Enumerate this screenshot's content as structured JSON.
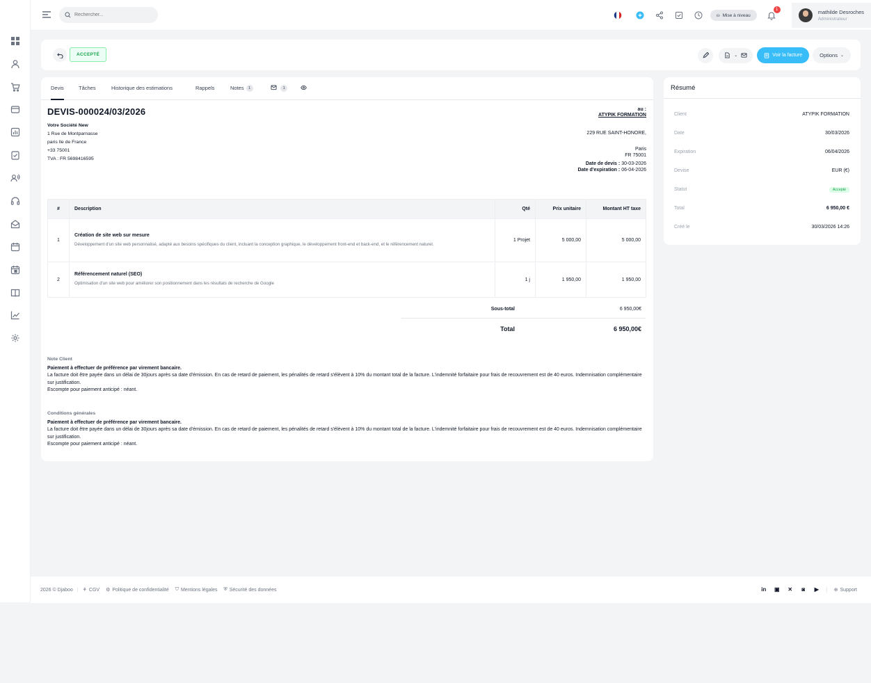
{
  "search": {
    "placeholder": "Rechercher..."
  },
  "topbar": {
    "upgrade": "Mise à niveau",
    "notif_count": "1",
    "user_name": "mathilde Desroches",
    "user_role": "Administrateur",
    "flag": "fr"
  },
  "status": {
    "badge": "ACCEPTÉ"
  },
  "actions": {
    "view_invoice": "Voir la facture",
    "options": "Options"
  },
  "tabs": [
    {
      "label": "Devis"
    },
    {
      "label": "Tâches"
    },
    {
      "label": "Historique des estimations"
    },
    {
      "label": "Rappels"
    },
    {
      "label": "Notes",
      "count": "1"
    },
    {
      "label": "",
      "count": "1"
    }
  ],
  "quote": {
    "number": "DEVIS-000024/03/2026",
    "company": "Votre Société New",
    "address1": "1 Rue de Montparnasse",
    "address2": "paris Ile de France",
    "address3": "+33 75001",
    "vat": "TVA : FR 5698416595",
    "to_label": "au :",
    "client": "ATYPIK FORMATION",
    "client_street": "229 RUE SAINT-HONORE,",
    "client_city": "Paris",
    "client_zip": "FR 75001",
    "date_label": "Date de devis :",
    "date_value": "30-03-2026",
    "exp_label": "Date d'expiration :",
    "exp_value": "06-04-2026"
  },
  "table": {
    "headers": [
      "#",
      "Description",
      "Qté",
      "Prix unitaire",
      "Montant HT taxe"
    ],
    "rows": [
      {
        "num": "1",
        "title": "Création de site web sur mesure",
        "desc": "Développement d'un site web personnalisé, adapté aux besoins spécifiques du client, incluant la conception graphique, le développement front-end et back-end, et le référencement naturel.",
        "qty": "1 Projet",
        "price": "5 000,00",
        "amount": "5 000,00"
      },
      {
        "num": "2",
        "title": "Référencement naturel (SEO)",
        "desc": "Optimisation d'un site web pour améliorer son positionnement dans les résultats de recherche de Google",
        "qty": "1 j",
        "price": "1 950,00",
        "amount": "1 950,00"
      }
    ]
  },
  "totals": {
    "subtotal_label": "Sous-total",
    "subtotal_value": "6 950,00€",
    "total_label": "Total",
    "total_value": "6 950,00€"
  },
  "notes": {
    "client_title": "Note Client",
    "client_line1": "Paiement à effectuer de préférence par virement bancaire.",
    "client_line2": "La facture doit être payée dans un délai de 30jours après sa date d'émission. En cas de retard de paiement, les pénalités de retard s'élèvent à 10% du montant total de la facture. L'indemnité forfaitaire pour frais de recouvrement est de 40 euros. Indemnisation complémentaire sur justification.",
    "client_line3": "Escompte pour paiement anticipé : néant.",
    "terms_title": "Conditions générales",
    "terms_line1": "Paiement à effectuer de préférence par virement bancaire.",
    "terms_line2": "La facture doit être payée dans un délai de 30jours après sa date d'émission. En cas de retard de paiement, les pénalités de retard s'élèvent à 10% du montant total de la facture. L'indemnité forfaitaire pour frais de recouvrement est de 40 euros. Indemnisation complémentaire sur justification.",
    "terms_line3": "Escompte pour paiement anticipé : néant."
  },
  "summary": {
    "title": "Résumé",
    "rows": [
      {
        "k": "Client",
        "v": "ATYPIK FORMATION"
      },
      {
        "k": "Date",
        "v": "30/03/2026"
      },
      {
        "k": "Expiration",
        "v": "06/04/2026"
      },
      {
        "k": "Devise",
        "v": "EUR (€)"
      },
      {
        "k": "Statut",
        "v": "Accepté"
      },
      {
        "k": "Total",
        "v": "6 950,00 €"
      },
      {
        "k": "Créé le",
        "v": "30/03/2026 14:26"
      }
    ]
  },
  "footer": {
    "copyright": "2026 © Djaboo",
    "cgv": "CGV",
    "privacy": "Politique de confidentialité",
    "legal": "Mentions légales",
    "security": "Sécurité des données",
    "support": "Support"
  },
  "colors": {
    "accent": "#38bdf8",
    "success": "#16a34a",
    "danger": "#ef4444"
  }
}
